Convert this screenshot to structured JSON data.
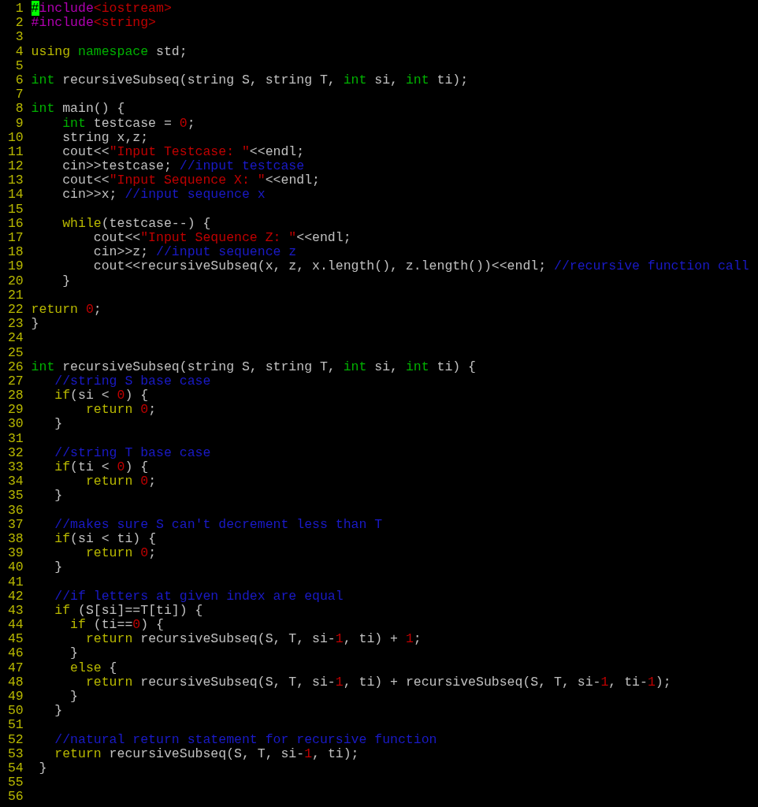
{
  "editor": {
    "lines": [
      {
        "number": "1",
        "tokens": [
          {
            "kind": "cursor",
            "text": "#"
          },
          {
            "kind": "preproc",
            "text": "include"
          },
          {
            "kind": "string",
            "text": "<iostream>"
          }
        ]
      },
      {
        "number": "2",
        "tokens": [
          {
            "kind": "preproc",
            "text": "#include"
          },
          {
            "kind": "string",
            "text": "<string>"
          }
        ]
      },
      {
        "number": "3"
      },
      {
        "number": "4",
        "tokens": [
          {
            "kind": "keyword",
            "text": "using"
          },
          {
            "kind": "type",
            "text": " namespace"
          },
          {
            "kind": "plain",
            "text": " std;"
          }
        ]
      },
      {
        "number": "5"
      },
      {
        "number": "6",
        "tokens": [
          {
            "kind": "type",
            "text": "int"
          },
          {
            "kind": "plain",
            "text": " recursiveSubseq(string S, string T,"
          },
          {
            "kind": "type",
            "text": " int"
          },
          {
            "kind": "plain",
            "text": " si,"
          },
          {
            "kind": "type",
            "text": " int"
          },
          {
            "kind": "plain",
            "text": " ti);"
          }
        ]
      },
      {
        "number": "7"
      },
      {
        "number": "8",
        "tokens": [
          {
            "kind": "type",
            "text": "int"
          },
          {
            "kind": "plain",
            "text": " main() {"
          }
        ]
      },
      {
        "number": "9",
        "tokens": [
          {
            "kind": "type",
            "text": "    int"
          },
          {
            "kind": "plain",
            "text": " testcase = "
          },
          {
            "kind": "number",
            "text": "0"
          },
          {
            "kind": "plain",
            "text": ";"
          }
        ]
      },
      {
        "number": "10",
        "tokens": [
          {
            "kind": "plain",
            "text": "    string x,z;"
          }
        ]
      },
      {
        "number": "11",
        "tokens": [
          {
            "kind": "plain",
            "text": "    cout<<"
          },
          {
            "kind": "string",
            "text": "\"Input Testcase: \""
          },
          {
            "kind": "plain",
            "text": "<<endl;"
          }
        ]
      },
      {
        "number": "12",
        "tokens": [
          {
            "kind": "plain",
            "text": "    cin>>testcase; "
          },
          {
            "kind": "comment",
            "text": "//input testcase"
          }
        ]
      },
      {
        "number": "13",
        "tokens": [
          {
            "kind": "plain",
            "text": "    cout<<"
          },
          {
            "kind": "string",
            "text": "\"Input Sequence X: \""
          },
          {
            "kind": "plain",
            "text": "<<endl;"
          }
        ]
      },
      {
        "number": "14",
        "tokens": [
          {
            "kind": "plain",
            "text": "    cin>>x; "
          },
          {
            "kind": "comment",
            "text": "//input sequence x"
          }
        ]
      },
      {
        "number": "15"
      },
      {
        "number": "16",
        "tokens": [
          {
            "kind": "keyword",
            "text": "    while"
          },
          {
            "kind": "plain",
            "text": "(testcase--) {"
          }
        ]
      },
      {
        "number": "17",
        "tokens": [
          {
            "kind": "plain",
            "text": "        cout<<"
          },
          {
            "kind": "string",
            "text": "\"Input Sequence Z: \""
          },
          {
            "kind": "plain",
            "text": "<<endl;"
          }
        ]
      },
      {
        "number": "18",
        "tokens": [
          {
            "kind": "plain",
            "text": "        cin>>z; "
          },
          {
            "kind": "comment",
            "text": "//input sequence z"
          }
        ]
      },
      {
        "number": "19",
        "tokens": [
          {
            "kind": "plain",
            "text": "        cout<<recursiveSubseq(x, z, x.length(), z.length())<<endl; "
          },
          {
            "kind": "comment",
            "text": "//recursive function call"
          }
        ]
      },
      {
        "number": "20",
        "tokens": [
          {
            "kind": "plain",
            "text": "    }"
          }
        ]
      },
      {
        "number": "21"
      },
      {
        "number": "22",
        "tokens": [
          {
            "kind": "keyword",
            "text": "return"
          },
          {
            "kind": "number",
            "text": " 0"
          },
          {
            "kind": "plain",
            "text": ";"
          }
        ]
      },
      {
        "number": "23",
        "tokens": [
          {
            "kind": "plain",
            "text": "}"
          }
        ]
      },
      {
        "number": "24"
      },
      {
        "number": "25"
      },
      {
        "number": "26",
        "tokens": [
          {
            "kind": "type",
            "text": "int"
          },
          {
            "kind": "plain",
            "text": " recursiveSubseq(string S, string T,"
          },
          {
            "kind": "type",
            "text": " int"
          },
          {
            "kind": "plain",
            "text": " si,"
          },
          {
            "kind": "type",
            "text": " int"
          },
          {
            "kind": "plain",
            "text": " ti) {"
          }
        ]
      },
      {
        "number": "27",
        "tokens": [
          {
            "kind": "comment",
            "text": "   //string S base case"
          }
        ]
      },
      {
        "number": "28",
        "tokens": [
          {
            "kind": "keyword",
            "text": "   if"
          },
          {
            "kind": "plain",
            "text": "(si < "
          },
          {
            "kind": "number",
            "text": "0"
          },
          {
            "kind": "plain",
            "text": ") {"
          }
        ]
      },
      {
        "number": "29",
        "tokens": [
          {
            "kind": "keyword",
            "text": "       return"
          },
          {
            "kind": "number",
            "text": " 0"
          },
          {
            "kind": "plain",
            "text": ";"
          }
        ]
      },
      {
        "number": "30",
        "tokens": [
          {
            "kind": "plain",
            "text": "   }"
          }
        ]
      },
      {
        "number": "31"
      },
      {
        "number": "32",
        "tokens": [
          {
            "kind": "comment",
            "text": "   //string T base case"
          }
        ]
      },
      {
        "number": "33",
        "tokens": [
          {
            "kind": "keyword",
            "text": "   if"
          },
          {
            "kind": "plain",
            "text": "(ti < "
          },
          {
            "kind": "number",
            "text": "0"
          },
          {
            "kind": "plain",
            "text": ") {"
          }
        ]
      },
      {
        "number": "34",
        "tokens": [
          {
            "kind": "keyword",
            "text": "       return"
          },
          {
            "kind": "number",
            "text": " 0"
          },
          {
            "kind": "plain",
            "text": ";"
          }
        ]
      },
      {
        "number": "35",
        "tokens": [
          {
            "kind": "plain",
            "text": "   }"
          }
        ]
      },
      {
        "number": "36"
      },
      {
        "number": "37",
        "tokens": [
          {
            "kind": "comment",
            "text": "   //makes sure S can't decrement less than T"
          }
        ]
      },
      {
        "number": "38",
        "tokens": [
          {
            "kind": "keyword",
            "text": "   if"
          },
          {
            "kind": "plain",
            "text": "(si < ti) {"
          }
        ]
      },
      {
        "number": "39",
        "tokens": [
          {
            "kind": "keyword",
            "text": "       return"
          },
          {
            "kind": "number",
            "text": " 0"
          },
          {
            "kind": "plain",
            "text": ";"
          }
        ]
      },
      {
        "number": "40",
        "tokens": [
          {
            "kind": "plain",
            "text": "   }"
          }
        ]
      },
      {
        "number": "41"
      },
      {
        "number": "42",
        "tokens": [
          {
            "kind": "comment",
            "text": "   //if letters at given index are equal"
          }
        ]
      },
      {
        "number": "43",
        "tokens": [
          {
            "kind": "keyword",
            "text": "   if"
          },
          {
            "kind": "plain",
            "text": " (S[si]==T[ti]) {"
          }
        ]
      },
      {
        "number": "44",
        "tokens": [
          {
            "kind": "keyword",
            "text": "     if"
          },
          {
            "kind": "plain",
            "text": " (ti=="
          },
          {
            "kind": "number",
            "text": "0"
          },
          {
            "kind": "plain",
            "text": ") {"
          }
        ]
      },
      {
        "number": "45",
        "tokens": [
          {
            "kind": "keyword",
            "text": "       return"
          },
          {
            "kind": "plain",
            "text": " recursiveSubseq(S, T, si-"
          },
          {
            "kind": "number",
            "text": "1"
          },
          {
            "kind": "plain",
            "text": ", ti) + "
          },
          {
            "kind": "number",
            "text": "1"
          },
          {
            "kind": "plain",
            "text": ";"
          }
        ]
      },
      {
        "number": "46",
        "tokens": [
          {
            "kind": "plain",
            "text": "     }"
          }
        ]
      },
      {
        "number": "47",
        "tokens": [
          {
            "kind": "keyword",
            "text": "     else"
          },
          {
            "kind": "plain",
            "text": " {"
          }
        ]
      },
      {
        "number": "48",
        "tokens": [
          {
            "kind": "keyword",
            "text": "       return"
          },
          {
            "kind": "plain",
            "text": " recursiveSubseq(S, T, si-"
          },
          {
            "kind": "number",
            "text": "1"
          },
          {
            "kind": "plain",
            "text": ", ti) + recursiveSubseq(S, T, si-"
          },
          {
            "kind": "number",
            "text": "1"
          },
          {
            "kind": "plain",
            "text": ", ti-"
          },
          {
            "kind": "number",
            "text": "1"
          },
          {
            "kind": "plain",
            "text": ");"
          }
        ]
      },
      {
        "number": "49",
        "tokens": [
          {
            "kind": "plain",
            "text": "     }"
          }
        ]
      },
      {
        "number": "50",
        "tokens": [
          {
            "kind": "plain",
            "text": "   }"
          }
        ]
      },
      {
        "number": "51"
      },
      {
        "number": "52",
        "tokens": [
          {
            "kind": "comment",
            "text": "   //natural return statement for recursive function"
          }
        ]
      },
      {
        "number": "53",
        "tokens": [
          {
            "kind": "keyword",
            "text": "   return"
          },
          {
            "kind": "plain",
            "text": " recursiveSubseq(S, T, si-"
          },
          {
            "kind": "number",
            "text": "1"
          },
          {
            "kind": "plain",
            "text": ", ti);"
          }
        ]
      },
      {
        "number": "54",
        "tokens": [
          {
            "kind": "plain",
            "text": " }"
          }
        ]
      },
      {
        "number": "55"
      },
      {
        "number": "56"
      }
    ]
  }
}
